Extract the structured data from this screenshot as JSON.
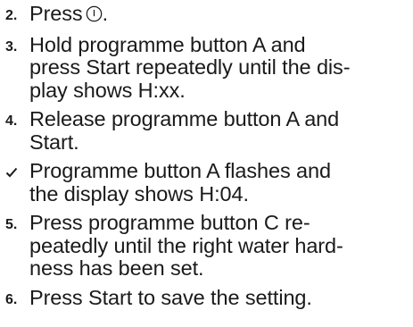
{
  "steps": [
    {
      "number": "2.",
      "lines": [
        "Press"
      ],
      "icon": "power-icon",
      "after_icon": "."
    },
    {
      "number": "3.",
      "lines": [
        "Hold programme button A and",
        "press Start repeatedly until the dis-",
        "play shows H:xx."
      ]
    },
    {
      "number": "4.",
      "lines": [
        "Release programme button A and",
        "Start."
      ]
    },
    {
      "marker_icon": "checkmark-icon",
      "lines": [
        "Programme button A flashes and",
        "the display shows H:04."
      ]
    },
    {
      "number": "5.",
      "lines": [
        "Press programme button C re-",
        "peatedly until the right water hard-",
        "ness has been set."
      ]
    },
    {
      "number": "6.",
      "lines": [
        "Press Start to save the setting."
      ]
    }
  ]
}
